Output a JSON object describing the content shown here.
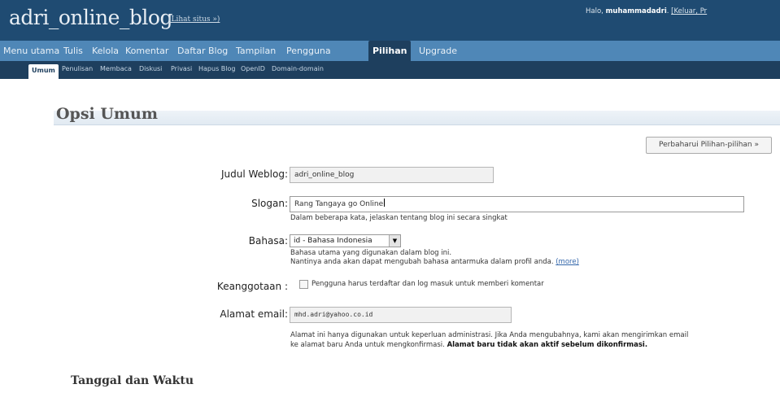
{
  "header": {
    "blog_title": "adri_online_blog",
    "view_site_link": "(Lihat situs »)",
    "greeting_prefix": "Halo, ",
    "username": "muhammadadri",
    "greeting_separator": ". ",
    "logout_link": "[Keluar, Pr"
  },
  "main_menu": {
    "items": [
      {
        "label": "Menu utama"
      },
      {
        "label": "Tulis"
      },
      {
        "label": "Kelola"
      },
      {
        "label": "Komentar"
      },
      {
        "label": "Daftar Blog"
      },
      {
        "label": "Tampilan"
      },
      {
        "label": "Pengguna"
      },
      {
        "label": "Pilihan"
      },
      {
        "label": "Upgrade"
      }
    ],
    "active": "Pilihan"
  },
  "sub_menu": {
    "items": [
      {
        "label": "Umum"
      },
      {
        "label": "Penulisan"
      },
      {
        "label": "Membaca"
      },
      {
        "label": "Diskusi"
      },
      {
        "label": "Privasi"
      },
      {
        "label": "Hapus Blog"
      },
      {
        "label": "OpenID"
      },
      {
        "label": "Domain-domain"
      }
    ],
    "active": "Umum"
  },
  "page": {
    "title": "Opsi Umum",
    "update_button": "Perbaharui Pilihan-pilihan »",
    "section_datetime": "Tanggal dan Waktu"
  },
  "form": {
    "weblog_title": {
      "label": "Judul Weblog:",
      "value": "adri_online_blog"
    },
    "tagline": {
      "label": "Slogan:",
      "value": "Rang Tangaya go Online",
      "help": "Dalam beberapa kata, jelaskan tentang blog ini secara singkat"
    },
    "language": {
      "label": "Bahasa:",
      "selected": "id - Bahasa Indonesia",
      "help_line1": "Bahasa utama yang digunakan dalam blog ini.",
      "help_line2": "Nantinya anda akan dapat mengubah bahasa antarmuka dalam profil anda. ",
      "help_link": "(more)"
    },
    "membership": {
      "label": "Keanggotaan :",
      "checkbox_label": "Pengguna harus terdaftar dan log masuk untuk memberi komentar",
      "checked": false
    },
    "email": {
      "label": "Alamat email:",
      "value": "mhd.adri@yahoo.co.id",
      "help_line1": "Alamat ini hanya digunakan untuk keperluan administrasi. Jika Anda mengubahnya, kami akan mengirimkan email",
      "help_line2": "ke alamat baru Anda untuk mengkonfirmasi. ",
      "help_bold": "Alamat baru tidak akan aktif sebelum dikonfirmasi."
    }
  },
  "colors": {
    "header_bg": "#1f4b72",
    "menu_bg": "#4f87b7",
    "submenu_bg": "#1e3f5e",
    "link": "#3366aa"
  }
}
